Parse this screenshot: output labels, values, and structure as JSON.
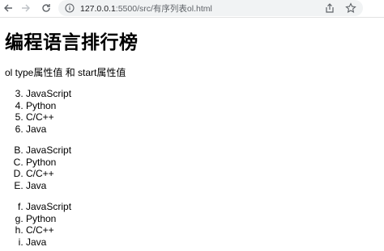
{
  "browser": {
    "url_host": "127.0.0.1",
    "url_rest": ":5500/src/有序列表ol.html"
  },
  "page": {
    "title": "编程语言排行榜",
    "description": "ol type属性值 和 start属性值",
    "lists": [
      {
        "type": "1",
        "start": 3,
        "items": [
          "JavaScript",
          "Python",
          "C/C++",
          "Java"
        ]
      },
      {
        "type": "A",
        "start": 2,
        "items": [
          "JavaScript",
          "Python",
          "C/C++",
          "Java"
        ]
      },
      {
        "type": "a",
        "start": 6,
        "items": [
          "JavaScript",
          "Python",
          "C/C++",
          "Java"
        ]
      }
    ]
  }
}
